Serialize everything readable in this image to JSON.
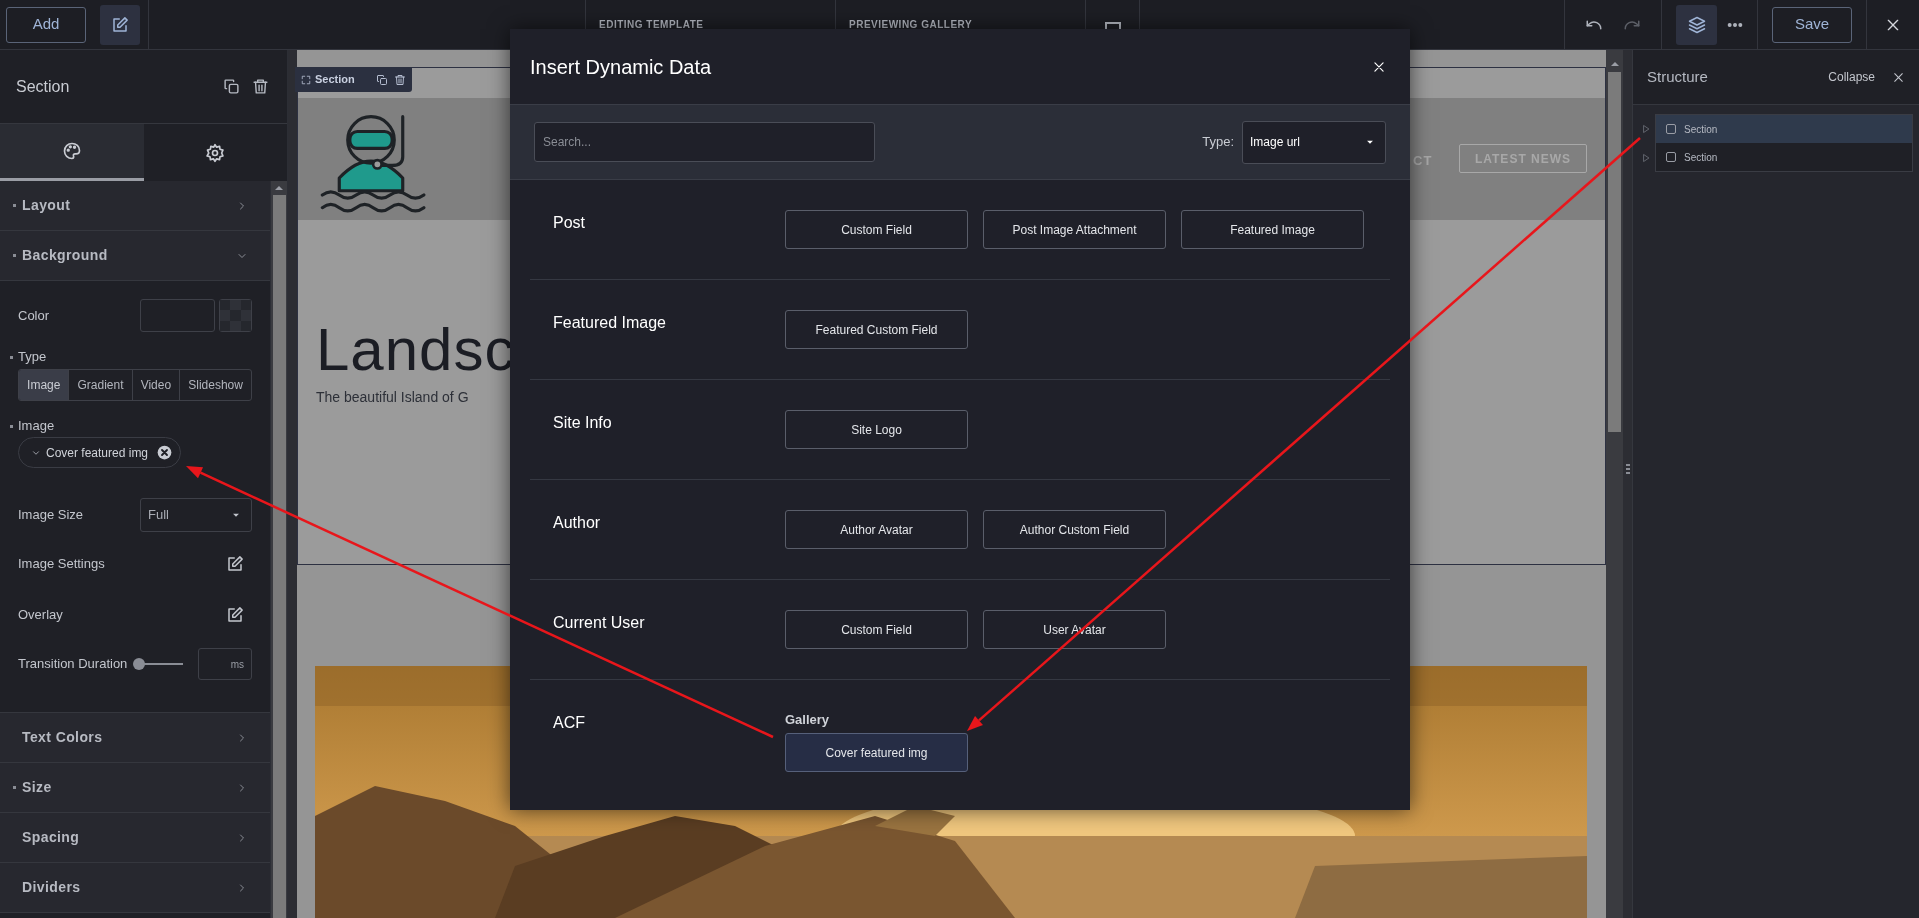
{
  "topbar": {
    "add_button": "Add",
    "center_labels": [
      "EDITING TEMPLATE",
      "PREVIEWING GALLERY"
    ],
    "save_button": "Save"
  },
  "left_panel": {
    "title": "Section",
    "tabs": [
      {
        "kind": "style",
        "selected": true
      },
      {
        "kind": "settings",
        "selected": false
      }
    ],
    "sections_top": [
      {
        "label": "Layout",
        "has_value": true,
        "expanded": false
      },
      {
        "label": "Background",
        "has_value": true,
        "expanded": true
      }
    ],
    "background": {
      "color_label": "Color",
      "type_label": "Type",
      "type_options": [
        {
          "label": "Image",
          "selected": true
        },
        {
          "label": "Gradient",
          "selected": false
        },
        {
          "label": "Video",
          "selected": false
        },
        {
          "label": "Slideshow",
          "selected": false
        }
      ],
      "image_label": "Image",
      "image_value": "Cover featured img",
      "image_size_label": "Image Size",
      "image_size_value": "Full",
      "image_settings_label": "Image Settings",
      "overlay_label": "Overlay",
      "transition": {
        "label": "Transition Duration",
        "level": 0,
        "unit": "ms"
      }
    },
    "sections_bottom": [
      {
        "label": "Text Colors",
        "has_value": false,
        "expanded": false
      },
      {
        "label": "Size",
        "has_value": true,
        "expanded": false
      },
      {
        "label": "Spacing",
        "has_value": false,
        "expanded": false
      },
      {
        "label": "Dividers",
        "has_value": false,
        "expanded": false
      }
    ]
  },
  "canvas": {
    "section_label": "Section",
    "nav_fragment": "CT",
    "nav_button": "LATEST NEWS",
    "hero_title": "Landsc",
    "hero_subtitle": "The beautiful Island of G"
  },
  "modal": {
    "title": "Insert Dynamic Data",
    "search_placeholder": "Search...",
    "type_label": "Type:",
    "type_value": "Image url",
    "groups": [
      {
        "label": "Post",
        "options": [
          {
            "label": "Custom Field",
            "selected": false
          },
          {
            "label": "Post Image Attachment",
            "selected": false
          },
          {
            "label": "Featured Image",
            "selected": false
          }
        ]
      },
      {
        "label": "Featured Image",
        "options": [
          {
            "label": "Featured Custom Field",
            "selected": false
          }
        ]
      },
      {
        "label": "Site Info",
        "options": [
          {
            "label": "Site Logo",
            "selected": false
          }
        ]
      },
      {
        "label": "Author",
        "options": [
          {
            "label": "Author Avatar",
            "selected": false
          },
          {
            "label": "Author Custom Field",
            "selected": false
          }
        ]
      },
      {
        "label": "Current User",
        "options": [
          {
            "label": "Custom Field",
            "selected": false
          },
          {
            "label": "User Avatar",
            "selected": false
          }
        ]
      },
      {
        "label": "ACF",
        "subheading": "Gallery",
        "options": [
          {
            "label": "Cover featured img",
            "selected": true
          }
        ]
      }
    ]
  },
  "structure": {
    "title": "Structure",
    "collapse": "Collapse",
    "items": [
      {
        "label": "Section",
        "selected": true
      },
      {
        "label": "Section",
        "selected": false
      }
    ]
  }
}
